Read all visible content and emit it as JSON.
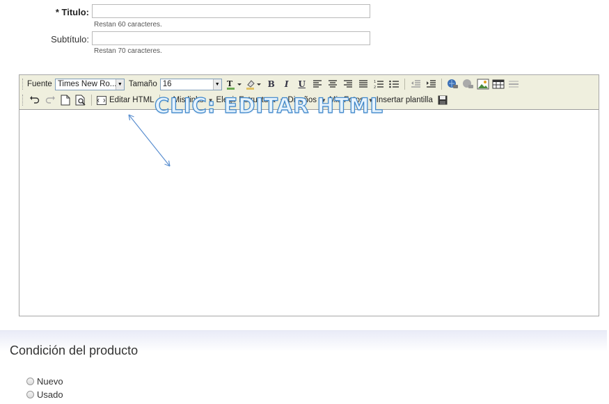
{
  "form": {
    "title_label": "* Titulo:",
    "title_value": "",
    "title_hint": "Restan 60 caracteres.",
    "subtitle_label": "Subtítulo:",
    "subtitle_value": "",
    "subtitle_hint": "Restan 70 caracteres."
  },
  "toolbar": {
    "font_label": "Fuente",
    "font_value": "Times New Ro...",
    "size_label": "Tamaño",
    "size_value": "16",
    "bold": "B",
    "italic": "I",
    "underline": "U",
    "edit_html": "Editar HTML",
    "my_links": "Mis links",
    "choose_structure": "Elegir Estructura",
    "designs": "Diseños",
    "my_photos": "Mis Fotos",
    "insert_template": "Insertar plantilla"
  },
  "editor": {
    "callout": "CLIC: EDITAR HTML"
  },
  "condition": {
    "heading": "Condición del producto",
    "options": [
      "Nuevo",
      "Usado"
    ]
  },
  "icons": {
    "text_color": "text-color-icon",
    "highlight": "highlight-color-icon",
    "align_left": "align-left-icon",
    "align_center": "align-center-icon",
    "align_right": "align-right-icon",
    "justify": "justify-icon",
    "ordered_list": "ordered-list-icon",
    "unordered_list": "unordered-list-icon",
    "outdent": "outdent-icon",
    "indent": "indent-icon",
    "link": "link-icon",
    "unlink": "unlink-icon",
    "image": "image-icon",
    "table": "table-icon",
    "hr": "horizontal-rule-icon",
    "undo": "undo-icon",
    "redo": "redo-icon",
    "new_doc": "new-document-icon",
    "preview": "preview-icon",
    "save": "save-icon"
  },
  "colors": {
    "toolbar_bg": "#efefde",
    "callout_stroke": "#3c86cb",
    "arrow": "#5b8fd0"
  }
}
